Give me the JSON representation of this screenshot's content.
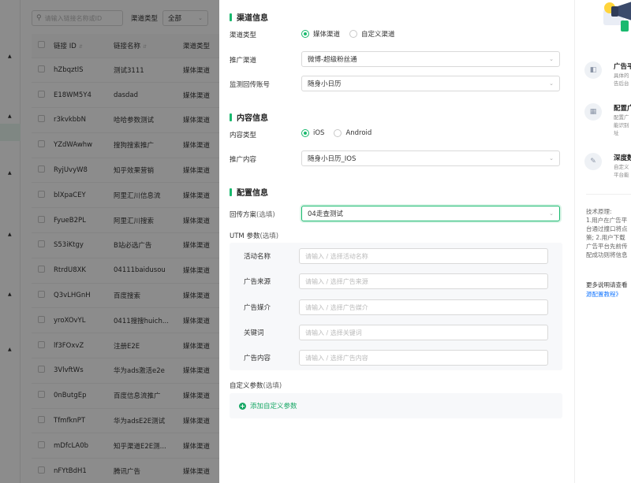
{
  "list": {
    "search_placeholder": "请输入链接名称或ID",
    "filter_label": "渠道类型",
    "filter_value": "全部",
    "columns": [
      "链接 ID",
      "链接名称",
      "渠道类型"
    ],
    "rows": [
      {
        "id": "hZbqztlS",
        "name": "测试3111",
        "channel": "媒体渠道"
      },
      {
        "id": "E18WM5Y4",
        "name": "dasdad",
        "channel": "媒体渠道"
      },
      {
        "id": "r3kvkbbN",
        "name": "哈哈参数测试",
        "channel": "媒体渠道"
      },
      {
        "id": "YZdWAwhw",
        "name": "搜狗搜索推广",
        "channel": "媒体渠道"
      },
      {
        "id": "RyjUvyW8",
        "name": "知乎效果营销",
        "channel": "媒体渠道"
      },
      {
        "id": "blXpaCEY",
        "name": "阿里汇川信息流",
        "channel": "媒体渠道"
      },
      {
        "id": "FyueB2PL",
        "name": "阿里汇川搜索",
        "channel": "媒体渠道"
      },
      {
        "id": "S53iKtgy",
        "name": "B站必选广告",
        "channel": "媒体渠道"
      },
      {
        "id": "RtrdU8XK",
        "name": "04111baidusou",
        "channel": "媒体渠道"
      },
      {
        "id": "Q3vLHGnH",
        "name": "百度搜索",
        "channel": "媒体渠道"
      },
      {
        "id": "yroXOvYL",
        "name": "0411搜搜huich...",
        "channel": "媒体渠道"
      },
      {
        "id": "lf3FOxvZ",
        "name": "注册E2E",
        "channel": "媒体渠道"
      },
      {
        "id": "3VlvftWs",
        "name": "华为ads激活e2e",
        "channel": "媒体渠道"
      },
      {
        "id": "0nButgEp",
        "name": "百度信息流推广",
        "channel": "媒体渠道"
      },
      {
        "id": "TfmfknPT",
        "name": "华为adsE2E测试",
        "channel": "媒体渠道"
      },
      {
        "id": "mDfcLA0b",
        "name": "知乎渠道E2E测...",
        "channel": "媒体渠道"
      },
      {
        "id": "nFYtBdH1",
        "name": "腾讯广告",
        "channel": "媒体渠道"
      }
    ]
  },
  "drawer": {
    "channel_section": {
      "title": "渠道信息",
      "type_label": "渠道类型",
      "type_options": [
        "媒体渠道",
        "自定义渠道"
      ],
      "type_selected": "媒体渠道",
      "promo_label": "推广渠道",
      "promo_value": "微博-超级粉丝通",
      "monitor_label": "监测回传账号",
      "monitor_value": "随身小日历"
    },
    "content_section": {
      "title": "内容信息",
      "type_label": "内容类型",
      "type_options": [
        "iOS",
        "Android"
      ],
      "type_selected": "iOS",
      "promo_label": "推广内容",
      "promo_value": "随身小日历_IOS"
    },
    "config_section": {
      "title": "配置信息",
      "callback_label": "回传方案",
      "optional": "(选填)",
      "callback_value": "04走查测试",
      "utm_label": "UTM 参数",
      "utm_fields": [
        {
          "label": "活动名称",
          "placeholder": "请输入 / 选择活动名称"
        },
        {
          "label": "广告来源",
          "placeholder": "请输入 / 选择广告来源"
        },
        {
          "label": "广告媒介",
          "placeholder": "请输入 / 选择广告媒介"
        },
        {
          "label": "关键词",
          "placeholder": "请输入 / 选择关键词"
        },
        {
          "label": "广告内容",
          "placeholder": "请输入 / 选择广告内容"
        }
      ],
      "custom_label": "自定义参数",
      "add_custom": "添加自定义参数"
    }
  },
  "help": {
    "features": [
      {
        "title": "广告平",
        "desc": [
          "具体的",
          "告后台"
        ]
      },
      {
        "title": "配置广",
        "desc": [
          "配置广",
          "能识别",
          "址"
        ]
      },
      {
        "title": "深度数",
        "desc": [
          "自定义",
          "平台能"
        ]
      }
    ],
    "tech_lines": [
      "技术原理:",
      "1.用户在广告平",
      "台通过撞口将点",
      "策; 2.用户下载",
      "广告平台先前传",
      "配成功则将信息"
    ],
    "more_prefix": "更多说明请查看",
    "more_link": "源配置教程》"
  },
  "colors": {
    "accent": "#19b96e",
    "link": "#1677ff"
  }
}
